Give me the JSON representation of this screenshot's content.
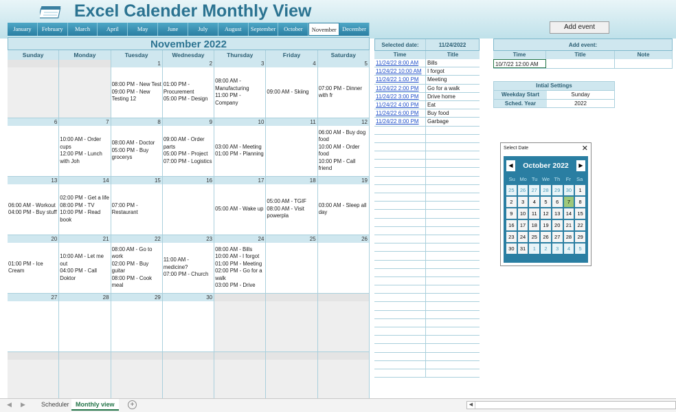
{
  "app": {
    "title": "Excel Calender Monthly View"
  },
  "months": [
    "January",
    "February",
    "March",
    "April",
    "May",
    "June",
    "July",
    "August",
    "September",
    "October",
    "November",
    "December"
  ],
  "active_month_index": 10,
  "calendar": {
    "title": "November 2022",
    "weekdays": [
      "Sunday",
      "Monday",
      "Tuesday",
      "Wednesday",
      "Thursday",
      "Friday",
      "Saturday"
    ],
    "weeks": [
      [
        {
          "day": "",
          "events": "",
          "blank": true
        },
        {
          "day": "",
          "events": "",
          "blank": true
        },
        {
          "day": "1",
          "events": "08:00 PM - New Test\n09:00 PM - New Testing 12"
        },
        {
          "day": "2",
          "events": "01:00 PM - Procurement\n05:00 PM - Design"
        },
        {
          "day": "3",
          "events": "08:00 AM - Manufacturing\n11:00 PM - Company"
        },
        {
          "day": "4",
          "events": "09:00 AM - Skiing"
        },
        {
          "day": "5",
          "events": "07:00 PM - Dinner with fr"
        }
      ],
      [
        {
          "day": "6",
          "events": ""
        },
        {
          "day": "7",
          "events": "10:00 AM - Order cups\n12:00 PM - Lunch with Joh"
        },
        {
          "day": "8",
          "events": "08:00 AM - Doctor\n05:00 PM - Buy grocerys"
        },
        {
          "day": "9",
          "events": "09:00 AM - Order parts\n05:00 PM - Project\n07:00 PM - Logistics"
        },
        {
          "day": "10",
          "events": "03:00 AM - Meeting\n01:00 PM - Planning"
        },
        {
          "day": "11",
          "events": ""
        },
        {
          "day": "12",
          "events": "06:00 AM - Buy dog food\n10:00 AM - Order food\n10:00 PM - Call friend"
        }
      ],
      [
        {
          "day": "13",
          "events": "06:00 AM - Workout\n04:00 PM - Buy stuff"
        },
        {
          "day": "14",
          "events": "02:00 PM - Get a life\n08:00 PM - TV\n10:00 PM - Read book"
        },
        {
          "day": "15",
          "events": "07:00 PM - Restaurant"
        },
        {
          "day": "16",
          "events": ""
        },
        {
          "day": "17",
          "events": "05:00 AM - Wake up"
        },
        {
          "day": "18",
          "events": "05:00 AM - TGIF\n08:00 AM - Visit powerpla"
        },
        {
          "day": "19",
          "events": "03:00 AM - Sleep all day"
        }
      ],
      [
        {
          "day": "20",
          "events": "01:00 PM - Ice Cream"
        },
        {
          "day": "21",
          "events": "10:00 AM - Let me out\n04:00 PM - Call Doktor"
        },
        {
          "day": "22",
          "events": "08:00 AM - Go to work\n02:00 PM - Buy guitar\n08:00 PM - Cook meal"
        },
        {
          "day": "23",
          "events": "11:00 AM - medicine?\n07:00 PM - Church"
        },
        {
          "day": "24",
          "events": "08:00 AM - Bills\n10:00 AM - I forgot\n01:00 PM - Meeting\n02:00 PM - Go for a walk\n03:00 PM - Drive"
        },
        {
          "day": "25",
          "events": ""
        },
        {
          "day": "26",
          "events": ""
        }
      ],
      [
        {
          "day": "27",
          "events": ""
        },
        {
          "day": "28",
          "events": ""
        },
        {
          "day": "29",
          "events": ""
        },
        {
          "day": "30",
          "events": ""
        },
        {
          "day": "",
          "events": "",
          "blank": true
        },
        {
          "day": "",
          "events": "",
          "blank": true
        },
        {
          "day": "",
          "events": "",
          "blank": true
        }
      ],
      [
        {
          "day": "",
          "events": "",
          "blank": true
        },
        {
          "day": "",
          "events": "",
          "blank": true
        },
        {
          "day": "",
          "events": "",
          "blank": true
        },
        {
          "day": "",
          "events": "",
          "blank": true
        },
        {
          "day": "",
          "events": "",
          "blank": true
        },
        {
          "day": "",
          "events": "",
          "blank": true
        },
        {
          "day": "",
          "events": "",
          "blank": true
        }
      ]
    ]
  },
  "schedule": {
    "selected_label": "Selected date:",
    "selected_value": "11/24/2022",
    "time_header": "Time",
    "title_header": "Title",
    "rows": [
      {
        "time": "11/24/22 8:00 AM",
        "title": "Bills"
      },
      {
        "time": "11/24/22 10:00 AM",
        "title": "I forgot"
      },
      {
        "time": "11/24/22 1:00 PM",
        "title": "Meeting"
      },
      {
        "time": "11/24/22 2:00 PM",
        "title": "Go for a walk"
      },
      {
        "time": "11/24/22 3:00 PM",
        "title": "Drive home"
      },
      {
        "time": "11/24/22 4:00 PM",
        "title": "Eat"
      },
      {
        "time": "11/24/22 6:00 PM",
        "title": "Buy food"
      },
      {
        "time": "11/24/22 8:00 PM",
        "title": "Garbage"
      },
      {
        "time": "",
        "title": ""
      },
      {
        "time": "",
        "title": ""
      },
      {
        "time": "",
        "title": ""
      },
      {
        "time": "",
        "title": ""
      },
      {
        "time": "",
        "title": ""
      },
      {
        "time": "",
        "title": ""
      },
      {
        "time": "",
        "title": ""
      },
      {
        "time": "",
        "title": ""
      },
      {
        "time": "",
        "title": ""
      },
      {
        "time": "",
        "title": ""
      },
      {
        "time": "",
        "title": ""
      },
      {
        "time": "",
        "title": ""
      },
      {
        "time": "",
        "title": ""
      },
      {
        "time": "",
        "title": ""
      },
      {
        "time": "",
        "title": ""
      },
      {
        "time": "",
        "title": ""
      },
      {
        "time": "",
        "title": ""
      },
      {
        "time": "",
        "title": ""
      },
      {
        "time": "",
        "title": ""
      },
      {
        "time": "",
        "title": ""
      },
      {
        "time": "",
        "title": ""
      },
      {
        "time": "",
        "title": ""
      },
      {
        "time": "",
        "title": ""
      },
      {
        "time": "",
        "title": ""
      },
      {
        "time": "",
        "title": ""
      },
      {
        "time": "",
        "title": ""
      },
      {
        "time": "",
        "title": ""
      },
      {
        "time": "",
        "title": ""
      },
      {
        "time": "",
        "title": ""
      },
      {
        "time": "",
        "title": ""
      }
    ]
  },
  "add_event": {
    "button_label": "Add event",
    "panel_title": "Add event:",
    "columns": [
      "Time",
      "Title",
      "Note"
    ],
    "time_value": "10/7/22 12:00 AM",
    "title_value": "",
    "note_value": ""
  },
  "settings": {
    "title": "Intial Settings",
    "weekday_start_label": "Weekday Start",
    "weekday_start_value": "Sunday",
    "sched_year_label": "Sched. Year",
    "sched_year_value": "2022"
  },
  "date_picker": {
    "title": "Select Date",
    "close_glyph": "✕",
    "prev_glyph": "◀",
    "next_glyph": "▶",
    "month_label": "October  2022",
    "dows": [
      "Su",
      "Mo",
      "Tu",
      "We",
      "Th",
      "Fr",
      "Sa"
    ],
    "days": [
      {
        "d": "25",
        "o": true
      },
      {
        "d": "26",
        "o": true
      },
      {
        "d": "27",
        "o": true
      },
      {
        "d": "28",
        "o": true
      },
      {
        "d": "29",
        "o": true
      },
      {
        "d": "30",
        "o": true
      },
      {
        "d": "1",
        "o": false
      },
      {
        "d": "2",
        "o": false
      },
      {
        "d": "3",
        "o": false
      },
      {
        "d": "4",
        "o": false
      },
      {
        "d": "5",
        "o": false
      },
      {
        "d": "6",
        "o": false
      },
      {
        "d": "7",
        "o": false,
        "t": true
      },
      {
        "d": "8",
        "o": false
      },
      {
        "d": "9",
        "o": false
      },
      {
        "d": "10",
        "o": false
      },
      {
        "d": "11",
        "o": false
      },
      {
        "d": "12",
        "o": false
      },
      {
        "d": "13",
        "o": false
      },
      {
        "d": "14",
        "o": false
      },
      {
        "d": "15",
        "o": false
      },
      {
        "d": "16",
        "o": false
      },
      {
        "d": "17",
        "o": false
      },
      {
        "d": "18",
        "o": false
      },
      {
        "d": "19",
        "o": false
      },
      {
        "d": "20",
        "o": false
      },
      {
        "d": "21",
        "o": false
      },
      {
        "d": "22",
        "o": false
      },
      {
        "d": "23",
        "o": false
      },
      {
        "d": "24",
        "o": false
      },
      {
        "d": "25",
        "o": false
      },
      {
        "d": "26",
        "o": false
      },
      {
        "d": "27",
        "o": false
      },
      {
        "d": "28",
        "o": false
      },
      {
        "d": "29",
        "o": false
      },
      {
        "d": "30",
        "o": false
      },
      {
        "d": "31",
        "o": false
      },
      {
        "d": "1",
        "o": true
      },
      {
        "d": "2",
        "o": true
      },
      {
        "d": "3",
        "o": true
      },
      {
        "d": "4",
        "o": true
      },
      {
        "d": "5",
        "o": true
      }
    ]
  },
  "sheets": {
    "nav_prev": "◀",
    "nav_next": "▶",
    "tabs": [
      "Scheduler",
      "Monthly view"
    ],
    "active": 1,
    "add_glyph": "+",
    "scroll_arrow": "◀"
  }
}
